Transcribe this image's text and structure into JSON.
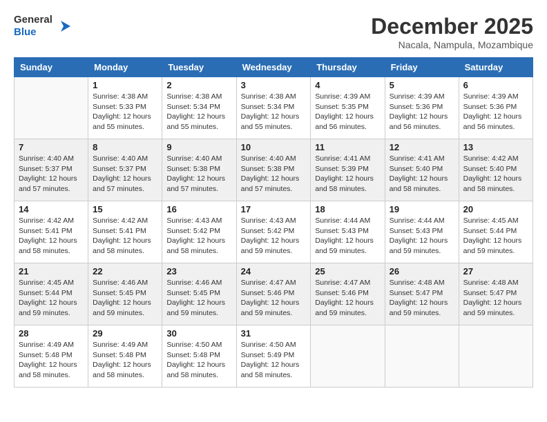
{
  "header": {
    "logo_line1": "General",
    "logo_line2": "Blue",
    "month": "December 2025",
    "location": "Nacala, Nampula, Mozambique"
  },
  "days_of_week": [
    "Sunday",
    "Monday",
    "Tuesday",
    "Wednesday",
    "Thursday",
    "Friday",
    "Saturday"
  ],
  "weeks": [
    [
      {
        "day": "",
        "info": ""
      },
      {
        "day": "1",
        "info": "Sunrise: 4:38 AM\nSunset: 5:33 PM\nDaylight: 12 hours\nand 55 minutes."
      },
      {
        "day": "2",
        "info": "Sunrise: 4:38 AM\nSunset: 5:34 PM\nDaylight: 12 hours\nand 55 minutes."
      },
      {
        "day": "3",
        "info": "Sunrise: 4:38 AM\nSunset: 5:34 PM\nDaylight: 12 hours\nand 55 minutes."
      },
      {
        "day": "4",
        "info": "Sunrise: 4:39 AM\nSunset: 5:35 PM\nDaylight: 12 hours\nand 56 minutes."
      },
      {
        "day": "5",
        "info": "Sunrise: 4:39 AM\nSunset: 5:36 PM\nDaylight: 12 hours\nand 56 minutes."
      },
      {
        "day": "6",
        "info": "Sunrise: 4:39 AM\nSunset: 5:36 PM\nDaylight: 12 hours\nand 56 minutes."
      }
    ],
    [
      {
        "day": "7",
        "info": "Sunrise: 4:40 AM\nSunset: 5:37 PM\nDaylight: 12 hours\nand 57 minutes."
      },
      {
        "day": "8",
        "info": "Sunrise: 4:40 AM\nSunset: 5:37 PM\nDaylight: 12 hours\nand 57 minutes."
      },
      {
        "day": "9",
        "info": "Sunrise: 4:40 AM\nSunset: 5:38 PM\nDaylight: 12 hours\nand 57 minutes."
      },
      {
        "day": "10",
        "info": "Sunrise: 4:40 AM\nSunset: 5:38 PM\nDaylight: 12 hours\nand 57 minutes."
      },
      {
        "day": "11",
        "info": "Sunrise: 4:41 AM\nSunset: 5:39 PM\nDaylight: 12 hours\nand 58 minutes."
      },
      {
        "day": "12",
        "info": "Sunrise: 4:41 AM\nSunset: 5:40 PM\nDaylight: 12 hours\nand 58 minutes."
      },
      {
        "day": "13",
        "info": "Sunrise: 4:42 AM\nSunset: 5:40 PM\nDaylight: 12 hours\nand 58 minutes."
      }
    ],
    [
      {
        "day": "14",
        "info": "Sunrise: 4:42 AM\nSunset: 5:41 PM\nDaylight: 12 hours\nand 58 minutes."
      },
      {
        "day": "15",
        "info": "Sunrise: 4:42 AM\nSunset: 5:41 PM\nDaylight: 12 hours\nand 58 minutes."
      },
      {
        "day": "16",
        "info": "Sunrise: 4:43 AM\nSunset: 5:42 PM\nDaylight: 12 hours\nand 58 minutes."
      },
      {
        "day": "17",
        "info": "Sunrise: 4:43 AM\nSunset: 5:42 PM\nDaylight: 12 hours\nand 59 minutes."
      },
      {
        "day": "18",
        "info": "Sunrise: 4:44 AM\nSunset: 5:43 PM\nDaylight: 12 hours\nand 59 minutes."
      },
      {
        "day": "19",
        "info": "Sunrise: 4:44 AM\nSunset: 5:43 PM\nDaylight: 12 hours\nand 59 minutes."
      },
      {
        "day": "20",
        "info": "Sunrise: 4:45 AM\nSunset: 5:44 PM\nDaylight: 12 hours\nand 59 minutes."
      }
    ],
    [
      {
        "day": "21",
        "info": "Sunrise: 4:45 AM\nSunset: 5:44 PM\nDaylight: 12 hours\nand 59 minutes."
      },
      {
        "day": "22",
        "info": "Sunrise: 4:46 AM\nSunset: 5:45 PM\nDaylight: 12 hours\nand 59 minutes."
      },
      {
        "day": "23",
        "info": "Sunrise: 4:46 AM\nSunset: 5:45 PM\nDaylight: 12 hours\nand 59 minutes."
      },
      {
        "day": "24",
        "info": "Sunrise: 4:47 AM\nSunset: 5:46 PM\nDaylight: 12 hours\nand 59 minutes."
      },
      {
        "day": "25",
        "info": "Sunrise: 4:47 AM\nSunset: 5:46 PM\nDaylight: 12 hours\nand 59 minutes."
      },
      {
        "day": "26",
        "info": "Sunrise: 4:48 AM\nSunset: 5:47 PM\nDaylight: 12 hours\nand 59 minutes."
      },
      {
        "day": "27",
        "info": "Sunrise: 4:48 AM\nSunset: 5:47 PM\nDaylight: 12 hours\nand 59 minutes."
      }
    ],
    [
      {
        "day": "28",
        "info": "Sunrise: 4:49 AM\nSunset: 5:48 PM\nDaylight: 12 hours\nand 58 minutes."
      },
      {
        "day": "29",
        "info": "Sunrise: 4:49 AM\nSunset: 5:48 PM\nDaylight: 12 hours\nand 58 minutes."
      },
      {
        "day": "30",
        "info": "Sunrise: 4:50 AM\nSunset: 5:48 PM\nDaylight: 12 hours\nand 58 minutes."
      },
      {
        "day": "31",
        "info": "Sunrise: 4:50 AM\nSunset: 5:49 PM\nDaylight: 12 hours\nand 58 minutes."
      },
      {
        "day": "",
        "info": ""
      },
      {
        "day": "",
        "info": ""
      },
      {
        "day": "",
        "info": ""
      }
    ]
  ]
}
